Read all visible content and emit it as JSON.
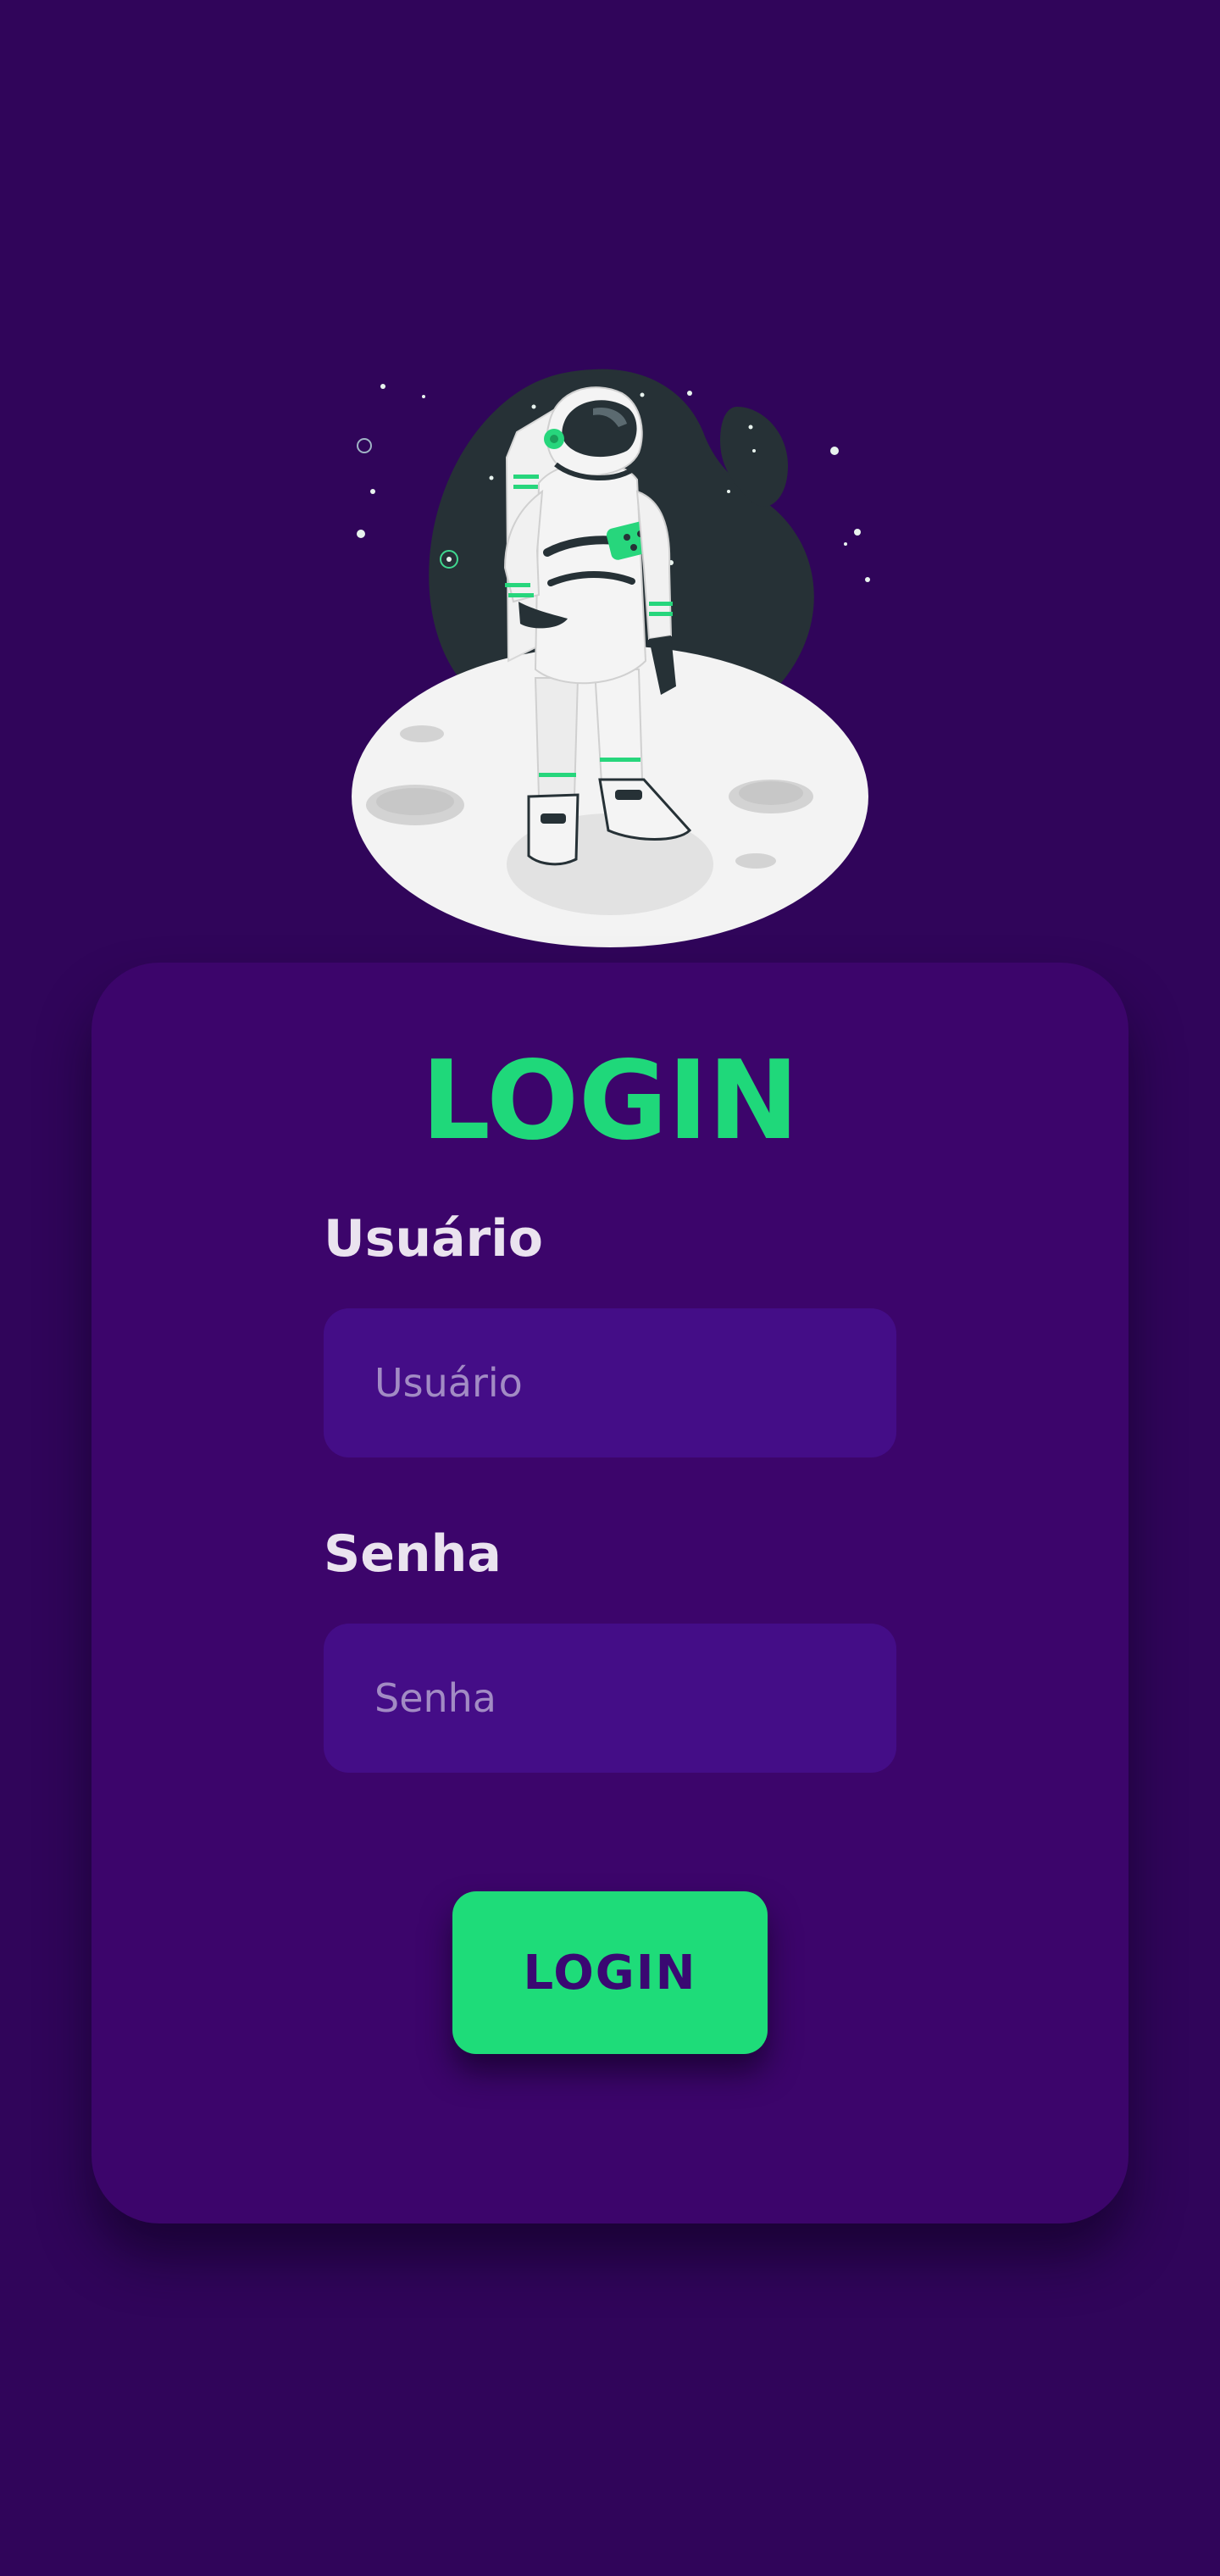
{
  "illustration": {
    "description_icon": "astronaut-on-moon-illustration",
    "colors": {
      "space_blob": "#263136",
      "moon": "#f2f2f2",
      "accent": "#27d67c"
    }
  },
  "login_form": {
    "title": "LOGIN",
    "username": {
      "label": "Usuário",
      "placeholder": "Usuário",
      "value": ""
    },
    "password": {
      "label": "Senha",
      "placeholder": "Senha",
      "value": ""
    },
    "submit_label": "LOGIN"
  },
  "colors": {
    "background": "#30055a",
    "card": "#3c056b",
    "input": "#440d87",
    "accent": "#1edc79",
    "button_text": "#3a0872",
    "label": "#eae3ef"
  }
}
